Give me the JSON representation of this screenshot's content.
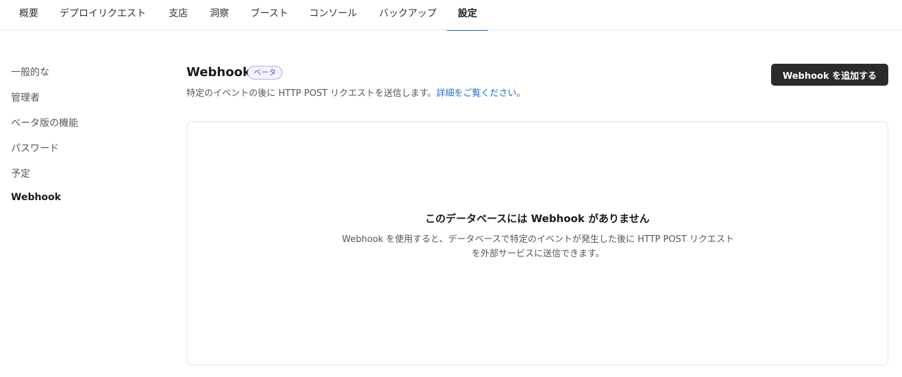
{
  "tabs": [
    {
      "label": "概要",
      "active": false
    },
    {
      "label": "デプロイリクエスト",
      "active": false
    },
    {
      "label": "支店",
      "active": false
    },
    {
      "label": "洞察",
      "active": false
    },
    {
      "label": "ブースト",
      "active": false
    },
    {
      "label": "コンソール",
      "active": false
    },
    {
      "label": "バックアップ",
      "active": false
    },
    {
      "label": "設定",
      "active": true
    }
  ],
  "sidebar": {
    "items": [
      {
        "label": "一般的な",
        "active": false
      },
      {
        "label": "管理者",
        "active": false
      },
      {
        "label": "ベータ版の機能",
        "active": false
      },
      {
        "label": "パスワード",
        "active": false
      },
      {
        "label": "予定",
        "active": false
      },
      {
        "label": "Webhook",
        "active": true
      }
    ]
  },
  "header": {
    "title": "Webhook",
    "badge": "ベータ",
    "subtitle_prefix": "特定のイベントの後に HTTP POST リクエストを送信します。",
    "subtitle_link": "詳細をご覧ください",
    "subtitle_suffix": "。",
    "add_button_label": "Webhook を追加する"
  },
  "empty_state": {
    "title": "このデータベースには Webhook がありません",
    "description": "Webhook を使用すると、データベースで特定のイベントが発生した後に HTTP POST リクエストを外部サービスに送信できます。"
  },
  "colors": {
    "accent": "#1f6fd0",
    "button_bg": "#2b2b2b",
    "badge_border": "#b7a6e6",
    "badge_text": "#6a4fc7"
  }
}
